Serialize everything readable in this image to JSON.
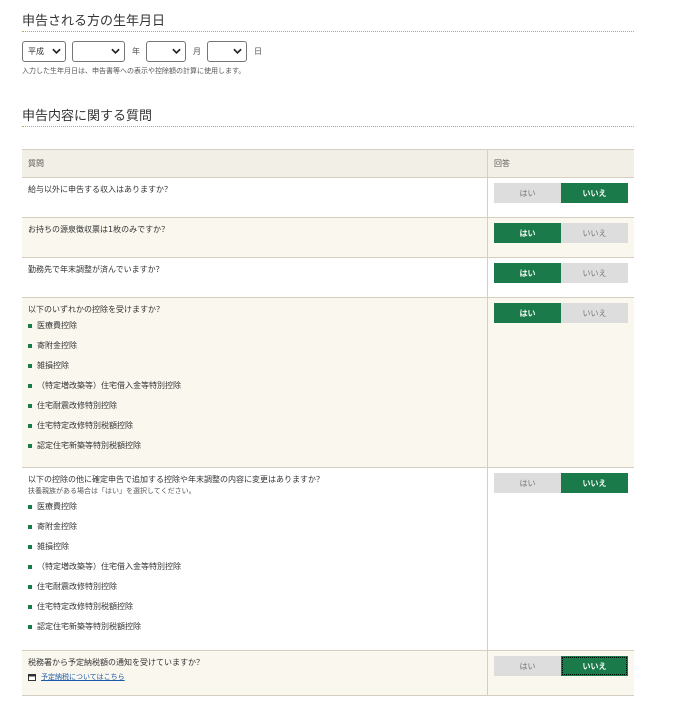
{
  "dob": {
    "title": "申告される方の生年月日",
    "era_value": "平成",
    "year_value": "",
    "month_value": "",
    "day_value": "",
    "year_unit": "年",
    "month_unit": "月",
    "day_unit": "日",
    "note": "入力した生年月日は、申告書等への表示や控除額の計算に使用します。"
  },
  "questions_section": {
    "title": "申告内容に関する質問",
    "header_question": "質問",
    "header_answer": "回答",
    "yes_label": "はい",
    "no_label": "いいえ",
    "rows": [
      {
        "question": "給与以外に申告する収入はありますか？",
        "answer": "いいえ"
      },
      {
        "question": "お持ちの源泉徴収票は1枚のみですか？",
        "answer": "はい"
      },
      {
        "question": "勤務先で年末調整が済んでいますか？",
        "answer": "はい"
      },
      {
        "question": "以下のいずれかの控除を受けますか？",
        "answer": "はい",
        "deductions": [
          "医療費控除",
          "寄附金控除",
          "雑損控除",
          "（特定増改築等）住宅借入金等特別控除",
          "住宅耐震改修特別控除",
          "住宅特定改修特別税額控除",
          "認定住宅新築等特別税額控除"
        ]
      },
      {
        "question": "以下の控除の他に確定申告で追加する控除や年末調整の内容に変更はありますか？",
        "note": "扶養親族がある場合は「はい」を選択してください。",
        "answer": "いいえ",
        "deductions": [
          "医療費控除",
          "寄附金控除",
          "雑損控除",
          "（特定増改築等）住宅借入金等特別控除",
          "住宅耐震改修特別控除",
          "住宅特定改修特別税額控除",
          "認定住宅新築等特別税額控除"
        ]
      },
      {
        "question": "税務署から予定納税額の通知を受けていますか？",
        "answer": "いいえ",
        "link": "予定納税についてはこちら"
      }
    ]
  },
  "colors": {
    "accent_green": "#1a7a49",
    "rule_gold": "#c8a05a",
    "inactive_gray": "#dddddd",
    "link_blue": "#1b5aa8"
  }
}
